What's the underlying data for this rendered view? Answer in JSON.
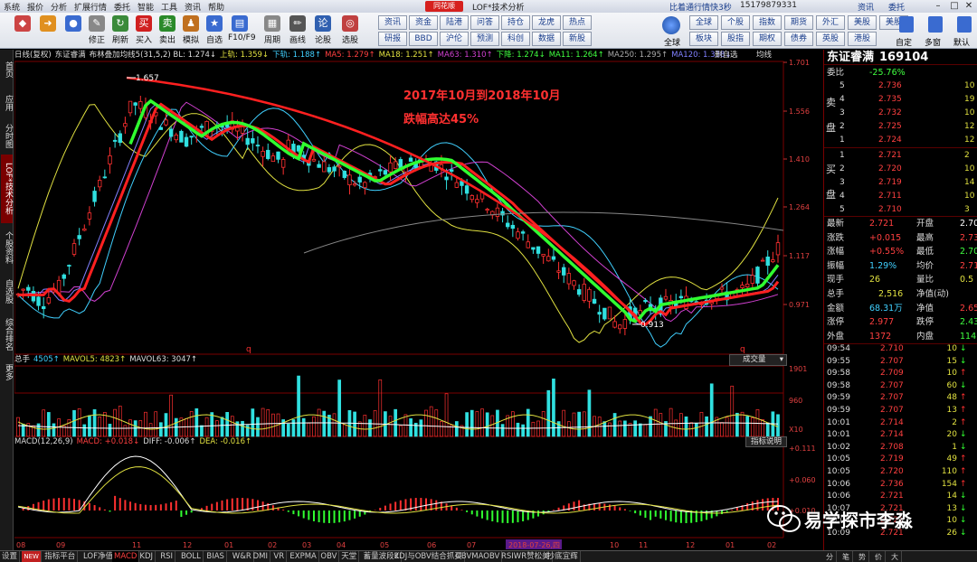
{
  "titlebar": {
    "menus": [
      "系统",
      "报价",
      "分析",
      "扩展行情",
      "委托",
      "智能",
      "工具",
      "资讯",
      "帮助"
    ],
    "logo": "同花顺",
    "app": "LOF*技术分析",
    "notice": "比着通行情快3秒",
    "phone": "15179879331",
    "btn1": "资讯",
    "btn2": "委托"
  },
  "toolbar": {
    "items": [
      {
        "label": "",
        "c": "#c44"
      },
      {
        "label": "",
        "c": "#e09020"
      },
      {
        "label": "",
        "c": "#3a6bd0"
      },
      {
        "label": "修正",
        "c": "#888"
      },
      {
        "label": "刷新",
        "c": "#3a8a3a"
      },
      {
        "label": "买入",
        "c": "#d02020"
      },
      {
        "label": "卖出",
        "c": "#2a8a2a"
      },
      {
        "label": "模拟",
        "c": "#c07020"
      },
      {
        "label": "自选",
        "c": "#3a6bd0"
      },
      {
        "label": "F10/F9",
        "c": "#3a6bd0"
      },
      {
        "label": "周期",
        "c": "#888"
      },
      {
        "label": "画线",
        "c": "#555"
      },
      {
        "label": "论股",
        "c": "#3060b0"
      },
      {
        "label": "选股",
        "c": "#c04040"
      }
    ],
    "boxes": [
      "资讯",
      "研报",
      "资金",
      "BBD",
      "陆港",
      "沪伦",
      "问答",
      "预测",
      "持仓",
      "科创",
      "龙虎",
      "数据",
      "热点",
      "新股"
    ],
    "right_boxes": [
      "全球",
      "板块",
      "个股",
      "股指",
      "指数",
      "期权",
      "期货",
      "债券",
      "外汇",
      "英股",
      "美股",
      "港股",
      "美股"
    ],
    "right_labels": [
      "全球",
      "自定",
      "多窗",
      "默认"
    ]
  },
  "sidebar": [
    "首页",
    "应用",
    "分时图",
    "LOF*技术分析",
    "个股资料",
    "自选股",
    "综合排名",
    "更多"
  ],
  "kline": {
    "header": [
      {
        "t": "日线(复权)",
        "c": "#ddd"
      },
      {
        "t": "东证睿满",
        "c": "#ddd"
      },
      {
        "t": "布林叠加均线5(31,5,2) BL: 1.274↓",
        "c": "#ddd"
      },
      {
        "t": "上轨: 1.359↓",
        "c": "#e0e040"
      },
      {
        "t": "下轨: 1.188↑",
        "c": "#40d0ff"
      },
      {
        "t": "MA5: 1.279↑",
        "c": "#ff4040"
      },
      {
        "t": "MA18: 1.251↑",
        "c": "#e0e040"
      },
      {
        "t": "MA63: 1.310↑",
        "c": "#d040d0"
      },
      {
        "t": "下降: 1.274↓",
        "c": "#40ff40"
      },
      {
        "t": "MA11: 1.264↑",
        "c": "#40ff40"
      },
      {
        "t": "MA250: 1.295↑",
        "c": "#aaa"
      },
      {
        "t": "MA120: 1.338↓",
        "c": "#8080ff"
      }
    ],
    "header_right": "删自选",
    "header_right2": "均线",
    "yticks": [
      "1.701",
      "1.556",
      "1.410",
      "1.264",
      "1.117",
      "0.971"
    ],
    "high": "1.657",
    "low": "0.913",
    "annotation1": "2017年10月到2018年10月",
    "annotation2": "跌幅高达45%",
    "marker": "q"
  },
  "volume": {
    "header": [
      {
        "t": "总手",
        "c": "#ddd"
      },
      {
        "t": "4505↑",
        "c": "#40d0ff"
      },
      {
        "t": "MAVOL5: 4823↑",
        "c": "#e0e040"
      },
      {
        "t": "MAVOL63: 3047↑",
        "c": "#ddd"
      }
    ],
    "yticks": [
      "1901",
      "960",
      "X10"
    ],
    "dropdown": "成交量"
  },
  "macd": {
    "header": [
      {
        "t": "MACD(12,26,9)",
        "c": "#ddd"
      },
      {
        "t": "MACD: +0.018↓",
        "c": "#ff4040"
      },
      {
        "t": "DIFF: -0.006↑",
        "c": "#ddd"
      },
      {
        "t": "DEA: -0.016↑",
        "c": "#e0e040"
      }
    ],
    "yticks": [
      "+0.111",
      "+0.060",
      "+0.010"
    ],
    "explain": "指标说明"
  },
  "xaxis": [
    "08",
    "09",
    "11",
    "12",
    "01",
    "02",
    "03",
    "04",
    "05",
    "06",
    "07",
    "2018-07-26,四",
    "10",
    "11",
    "12",
    "01",
    "02"
  ],
  "quote": {
    "name": "东证睿满",
    "code": "169104",
    "webi_label": "委比",
    "webi": "-25.76%",
    "webi_r": "",
    "sell": [
      {
        "n": "5",
        "p": "2.736",
        "v": "10"
      },
      {
        "n": "4",
        "p": "2.735",
        "v": "19"
      },
      {
        "n": "3",
        "p": "2.732",
        "v": "10"
      },
      {
        "n": "2",
        "p": "2.725",
        "v": "12"
      },
      {
        "n": "1",
        "p": "2.724",
        "v": "12"
      }
    ],
    "buy": [
      {
        "n": "1",
        "p": "2.721",
        "v": "2"
      },
      {
        "n": "2",
        "p": "2.720",
        "v": "10"
      },
      {
        "n": "3",
        "p": "2.719",
        "v": "14"
      },
      {
        "n": "4",
        "p": "2.711",
        "v": "10"
      },
      {
        "n": "5",
        "p": "2.710",
        "v": "3"
      }
    ],
    "sell_label": [
      "卖",
      "盘"
    ],
    "buy_label": [
      "买",
      "盘"
    ],
    "stats": [
      {
        "a": "最新",
        "av": "2.721",
        "ac": "#ff4040",
        "b": "开盘",
        "bv": "2.70",
        "bc": "#fff"
      },
      {
        "a": "涨跌",
        "av": "+0.015",
        "ac": "#ff4040",
        "b": "最高",
        "bv": "2.73",
        "bc": "#ff4040"
      },
      {
        "a": "涨幅",
        "av": "+0.55%",
        "ac": "#ff4040",
        "b": "最低",
        "bv": "2.70",
        "bc": "#40ff40"
      },
      {
        "a": "振幅",
        "av": "1.29%",
        "ac": "#40d0ff",
        "b": "均价",
        "bv": "2.71",
        "bc": "#ff4040"
      },
      {
        "a": "现手",
        "av": "26",
        "ac": "#e0e040",
        "b": "量比",
        "bv": "0.5",
        "bc": "#e0e040"
      },
      {
        "a": "总手",
        "av": "2,516",
        "ac": "#e0e040",
        "b": "净值(动)",
        "bv": "",
        "bc": "#fff"
      },
      {
        "a": "金额",
        "av": "68.31万",
        "ac": "#40d0ff",
        "b": "净值",
        "bv": "2.65",
        "bc": "#ff4040"
      },
      {
        "a": "涨停",
        "av": "2.977",
        "ac": "#ff4040",
        "b": "跌停",
        "bv": "2.43",
        "bc": "#40ff40"
      },
      {
        "a": "外盘",
        "av": "1372",
        "ac": "#ff4040",
        "b": "内盘",
        "bv": "114",
        "bc": "#40ff40"
      }
    ],
    "ticks": [
      {
        "t": "09:54",
        "p": "2.710",
        "v": "10",
        "d": "down"
      },
      {
        "t": "09:55",
        "p": "2.707",
        "v": "15",
        "d": "down"
      },
      {
        "t": "09:58",
        "p": "2.709",
        "v": "10",
        "d": "up"
      },
      {
        "t": "09:58",
        "p": "2.707",
        "v": "60",
        "d": "down"
      },
      {
        "t": "09:59",
        "p": "2.707",
        "v": "48",
        "d": "up"
      },
      {
        "t": "09:59",
        "p": "2.707",
        "v": "13",
        "d": "up"
      },
      {
        "t": "10:01",
        "p": "2.714",
        "v": "2",
        "d": "up"
      },
      {
        "t": "10:01",
        "p": "2.714",
        "v": "20",
        "d": "down"
      },
      {
        "t": "10:02",
        "p": "2.708",
        "v": "1",
        "d": "down"
      },
      {
        "t": "10:05",
        "p": "2.719",
        "v": "49",
        "d": "up"
      },
      {
        "t": "10:05",
        "p": "2.720",
        "v": "110",
        "d": "up"
      },
      {
        "t": "10:06",
        "p": "2.736",
        "v": "154",
        "d": "up"
      },
      {
        "t": "10:06",
        "p": "2.721",
        "v": "14",
        "d": "down"
      },
      {
        "t": "10:07",
        "p": "2.721",
        "v": "13",
        "d": "down"
      },
      {
        "t": "10:08",
        "p": "2.721",
        "v": "10",
        "d": "down"
      },
      {
        "t": "10:09",
        "p": "2.721",
        "v": "26",
        "d": "down"
      }
    ]
  },
  "bottom_tabs": [
    "设置",
    "NEW",
    "指标平台",
    "LOF净值",
    "MACD",
    "KDJ",
    "RSI",
    "BOLL",
    "BIAS",
    "W&R",
    "DMI",
    "VR",
    "EXPMA",
    "OBV",
    "天堂",
    "蓄量波段2",
    "KDJ与OBV结合抓买",
    "OBVMAOBV",
    "RSIWR赞松美",
    "抄底宜辉"
  ],
  "right_tabs": [
    "分",
    "笔",
    "势",
    "价",
    "大"
  ],
  "watermark": "易学探市李淼",
  "colors": {
    "up": "#ff3030",
    "down": "#30ff30",
    "accent": "#d6201e"
  }
}
